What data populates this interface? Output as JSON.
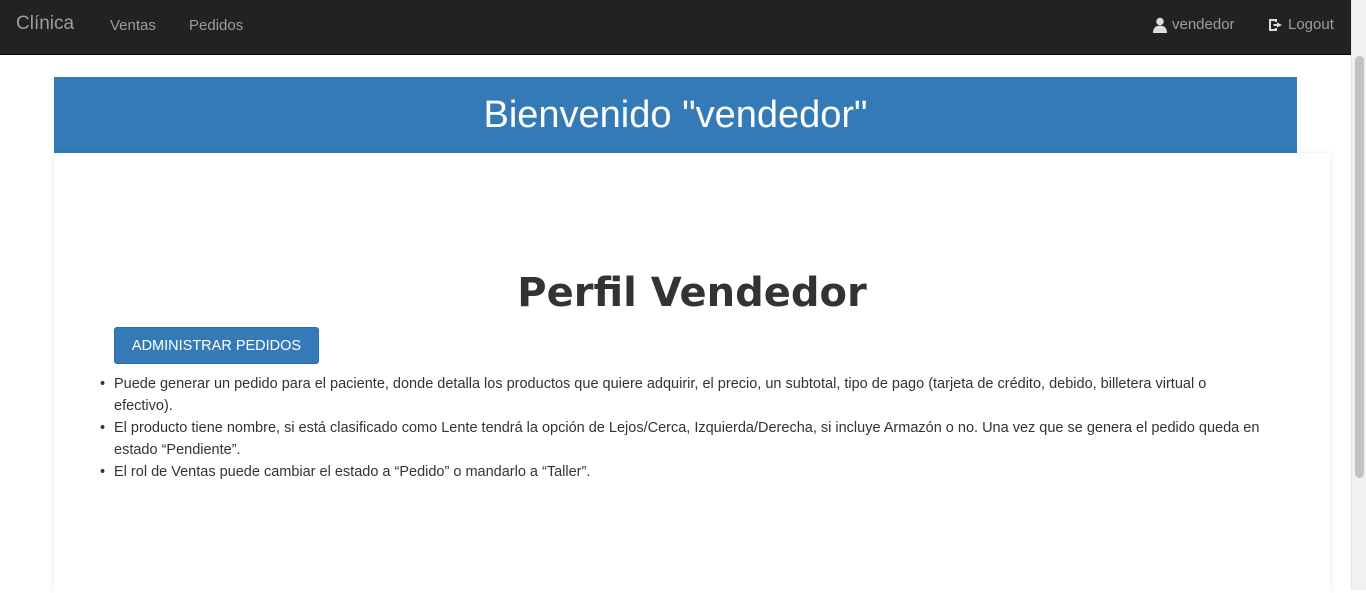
{
  "navbar": {
    "brand": "Clínica",
    "links": [
      {
        "label": "Ventas"
      },
      {
        "label": "Pedidos"
      }
    ],
    "user": {
      "label": "vendedor",
      "icon": "user-icon"
    },
    "logout": {
      "label": "Logout",
      "icon": "logout-icon"
    }
  },
  "banner": {
    "title": "Bienvenido \"vendedor\""
  },
  "main": {
    "title": "Perfil Vendedor",
    "admin_button": "ADMINISTRAR PEDIDOS",
    "items": [
      "Puede generar un pedido para el paciente, donde detalla los productos que quiere adquirir, el precio, un subtotal, tipo de pago (tarjeta de crédito, debido, billetera virtual o efectivo).",
      "El producto tiene nombre, si está clasificado como Lente tendrá la opción de Lejos/Cerca, Izquierda/Derecha, si incluye Armazón o no. Una vez que se genera el pedido queda en estado “Pendiente”.",
      "El rol de Ventas puede cambiar el estado a “Pedido” o mandarlo a “Taller”."
    ]
  },
  "colors": {
    "navbar_bg": "#222222",
    "nav_text": "#9d9d9d",
    "primary": "#337ab7",
    "text": "#333333"
  }
}
